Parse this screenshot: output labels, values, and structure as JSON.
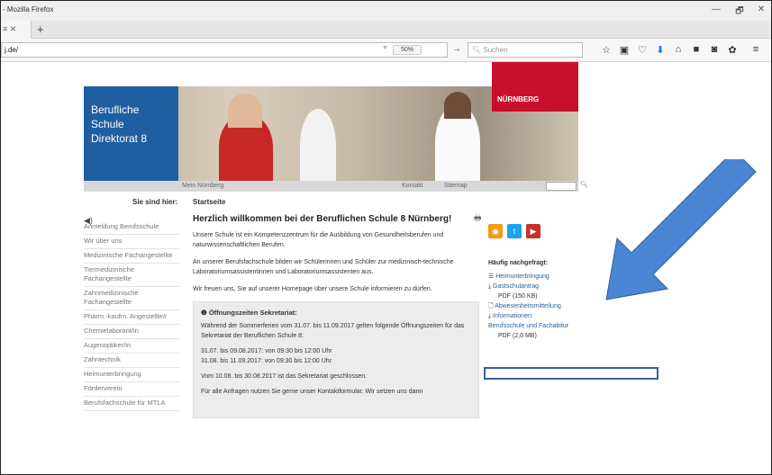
{
  "browser": {
    "window_title": "- Mozilla Firefox",
    "minimize": "—",
    "restore": "🗗",
    "close": "✕",
    "tab_stub": "≡ ✕",
    "new_tab": "+",
    "url": "j.de/",
    "zoom": "50%",
    "search_placeholder": "Suchen",
    "go": "→"
  },
  "banner": {
    "school_line1": "Berufliche",
    "school_line2": "Schule",
    "school_line3": "Direktorat 8",
    "brand": "NÜRNBERG"
  },
  "topnav": {
    "mein": "Mein Nürnberg",
    "kontakt": "Kontakt",
    "sitemap": "Sitemap"
  },
  "breadcrumb": {
    "label": "Sie sind hier:",
    "current": "Startseite"
  },
  "sidebar": {
    "items": [
      "Anmeldung Berufsschule",
      "Wir über uns",
      "Medizinische Fachangestellte",
      "Tiermedizinische Fachangestellte",
      "Zahnmedizinische Fachangestellte",
      "Pharm.-kaufm. Angestellte/r",
      "Chemielaborant/in",
      "Augenoptiker/in",
      "Zahntechnik",
      "Heimunterbringung",
      "Förderverein",
      "Berufsfachschule für MTLA"
    ]
  },
  "main": {
    "heading": "Herzlich willkommen bei der Beruflichen Schule 8 Nürnberg!",
    "p1": "Unsere Schule ist ein Kompetenzzentrum für die Ausbildung von Gesundheitsberufen und naturwissenschaftlichen Berufen.",
    "p2": "An unserer Berufsfachschule bilden wir Schülerinnen und Schüler zur medizinisch-technische Laboratoriumsassistentinnen und Laboratoriumsassistenten aus.",
    "p3": "Wir freuen uns, Sie auf unserer Homepage über unsere Schule informieren zu dürfen.",
    "info_title": "Öffnungszeiten Sekretariat:",
    "info1": "Während der Sommerferien vom 31.07. bis 11.09.2017 gelten folgende Öffnungszeiten für das Sekretariat der Beruflichen Schule 8:",
    "info2": "31.07. bis 09.08.2017: von 09:30 bis 12:00 Uhr",
    "info3": "31.08. bis 11.09.2017: von 09:30 bis 12:00 Uhr",
    "info4": "Vom 10.08. bis 30.08.2017 ist das Sekretariat geschlossen.",
    "info5": "Für alle Anfragen nutzen Sie gerne unser Kontaktformular. Wir setzen uns dann"
  },
  "right": {
    "faq_title": "Häufig nachgefragt:",
    "links": [
      "Heimunterbringung",
      "Gastschulantrag",
      "PDF (150 KB)",
      "Abwesenheitsmitteilung",
      "Informationen: Berufsschule und Fachabitur",
      "PDF (2,0 MB)"
    ]
  },
  "colors": {
    "blue": "#1f5fa0",
    "brand_red": "#c8102e",
    "arrow": "#4a86d4"
  }
}
